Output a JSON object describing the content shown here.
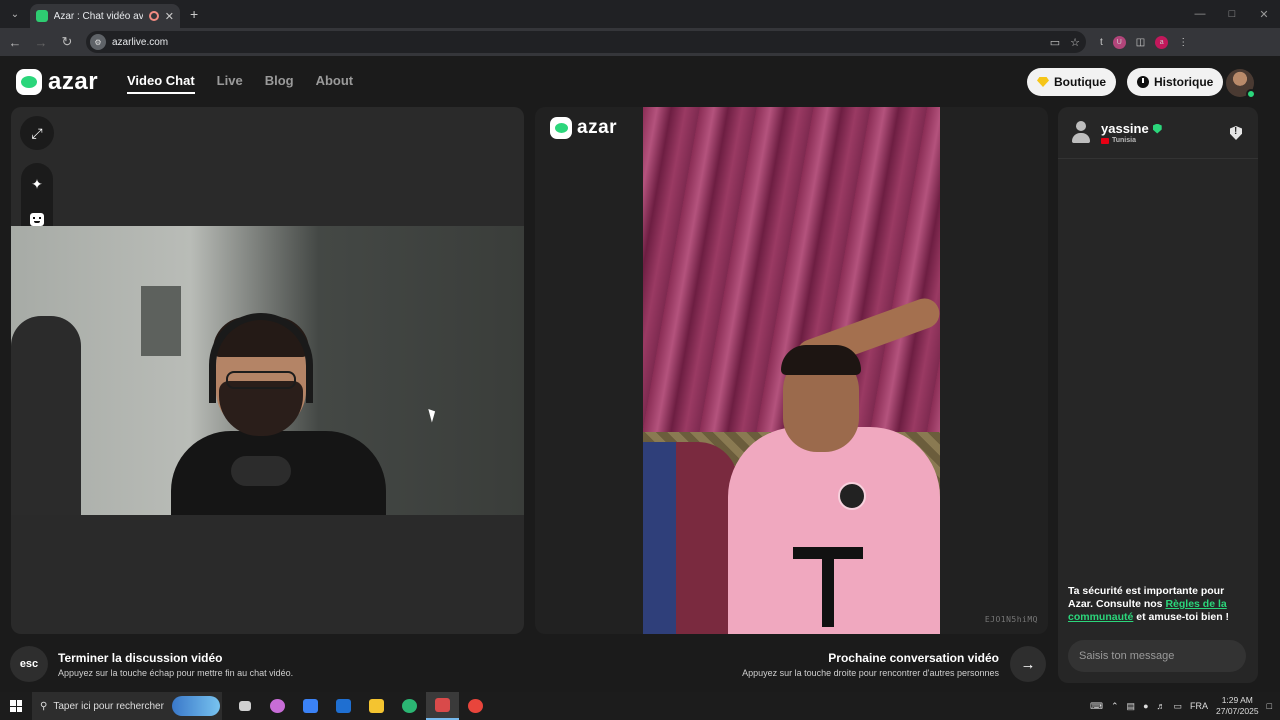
{
  "browser": {
    "tab_title": "Azar : Chat vidéo avec de n",
    "url": "azarlive.com",
    "profile_initial": "a",
    "ext_badge": "U"
  },
  "header": {
    "logo_text": "azar",
    "nav": [
      {
        "label": "Video Chat",
        "active": true
      },
      {
        "label": "Live",
        "active": false
      },
      {
        "label": "Blog",
        "active": false
      },
      {
        "label": "About",
        "active": false
      }
    ],
    "shop_label": "Boutique",
    "history_label": "Historique"
  },
  "center": {
    "logo_text": "azar",
    "video_id": "EJO1N5hiMQ"
  },
  "chat": {
    "username": "yassine",
    "country": "Tunisia",
    "safety_text_1": "Ta sécurité est importante pour Azar. Consulte nos ",
    "safety_link": "Règles de la communauté",
    "safety_text_2": " et amuse-toi bien !",
    "input_placeholder": "Saisis ton message"
  },
  "controls": {
    "esc_label": "esc",
    "end_title": "Terminer la discussion vidéo",
    "end_sub": "Appuyez sur la touche échap pour mettre fin au chat vidéo.",
    "next_title": "Prochaine conversation vidéo",
    "next_sub": "Appuyez sur la touche droite pour rencontrer d'autres personnes"
  },
  "taskbar": {
    "search_placeholder": "Taper ici pour rechercher",
    "lang": "FRA",
    "time": "1:29 AM",
    "date": "27/07/2025",
    "apps": [
      {
        "name": "task-view",
        "color": "#cfcfcf"
      },
      {
        "name": "copilot",
        "color": "#c86dd7"
      },
      {
        "name": "store",
        "color": "#3b82f6"
      },
      {
        "name": "outlook",
        "color": "#1f6fd1"
      },
      {
        "name": "file-explorer",
        "color": "#f4c430"
      },
      {
        "name": "edge",
        "color": "#2bb673"
      },
      {
        "name": "app-red",
        "color": "#d94a4a"
      },
      {
        "name": "chrome",
        "color": "#e8453c"
      }
    ]
  },
  "colors": {
    "accent": "#2bd67b",
    "background": "#1b1b1b",
    "panel": "#262626"
  }
}
